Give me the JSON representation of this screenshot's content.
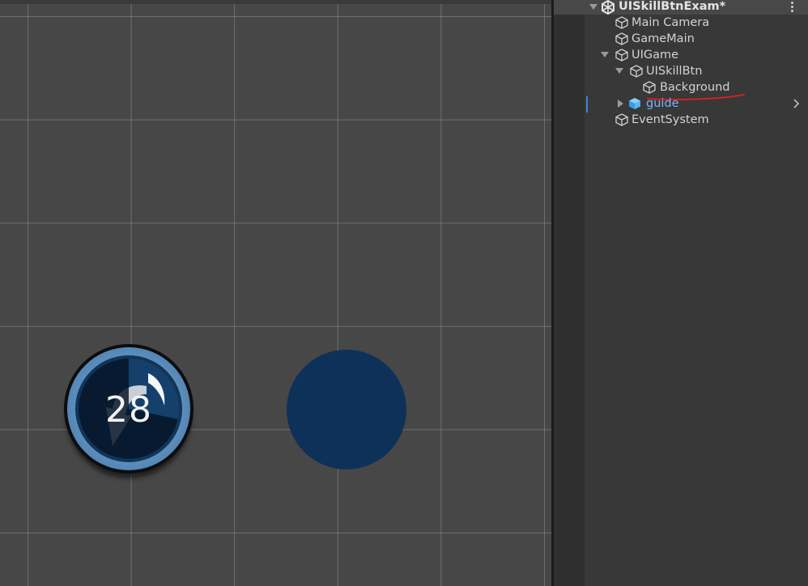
{
  "colors": {
    "scene_background": "#474747",
    "grid_line": "#8a8a8a",
    "hierarchy_background": "#383838",
    "prefab_blue": "#7ab4ff",
    "text": "#d2d2d2",
    "annotation_red": "#e02020",
    "skill_button_blue": "#15406b",
    "placeholder_circle": "#0e3159"
  },
  "scene_view": {
    "skill_button": {
      "cooldown_text": "28",
      "icon": "return-arrow-icon"
    },
    "placeholder_circle": "background-image-preview"
  },
  "hierarchy": {
    "scene_name": "UISkillBtnExam*",
    "items": [
      {
        "label": "Main Camera",
        "icon": "gameobject-cube-icon",
        "depth": 1
      },
      {
        "label": "GameMain",
        "icon": "gameobject-cube-icon",
        "depth": 1
      },
      {
        "label": "UIGame",
        "icon": "gameobject-cube-icon",
        "depth": 1,
        "expanded": true
      },
      {
        "label": "UISkillBtn",
        "icon": "gameobject-cube-icon",
        "depth": 2,
        "expanded": true
      },
      {
        "label": "Background",
        "icon": "gameobject-cube-icon",
        "depth": 3,
        "annotated": true
      },
      {
        "label": "guide",
        "icon": "prefab-cube-icon",
        "depth": 2,
        "expanded": false,
        "prefab": true
      },
      {
        "label": "EventSystem",
        "icon": "gameobject-cube-icon",
        "depth": 1
      }
    ]
  }
}
